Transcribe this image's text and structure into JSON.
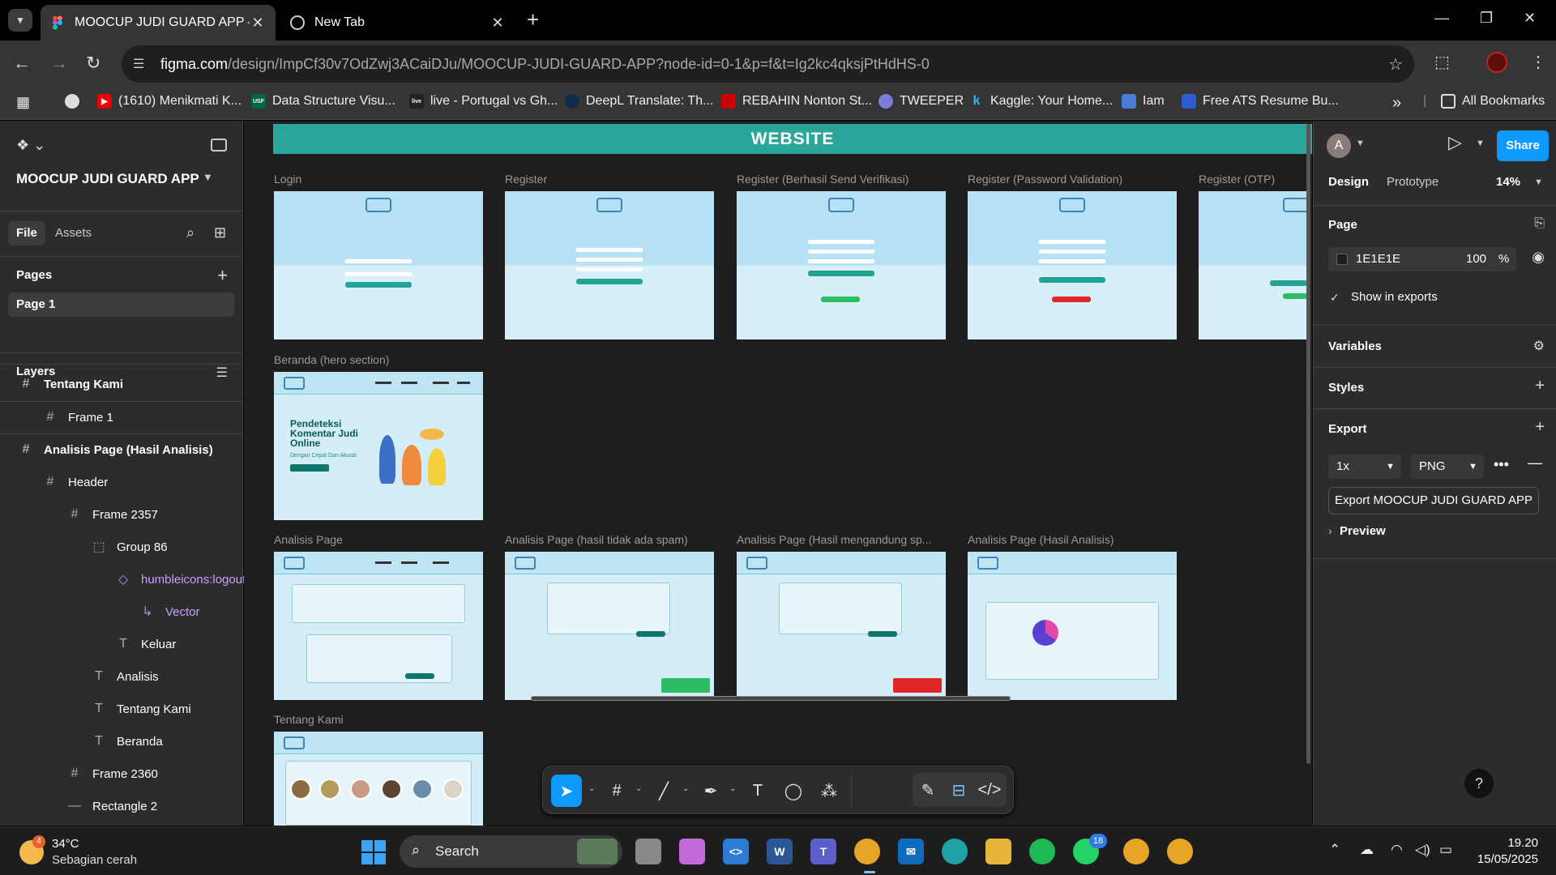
{
  "browser": {
    "tabs": [
      {
        "title": "MOOCUP JUDI GUARD APP – Fi",
        "active": true
      },
      {
        "title": "New Tab",
        "active": false
      }
    ],
    "url_host": "figma.com",
    "url_path": "/design/ImpCf30v7OdZwj3ACaiDJu/MOOCUP-JUDI-GUARD-APP?node-id=0-1&p=f&t=Ig2kc4qksjPtHdHS-0",
    "bookmarks": [
      "(1610) Menikmati K...",
      "Data Structure Visu...",
      "live - Portugal vs Gh...",
      "DeepL Translate: Th...",
      "REBAHIN Nonton St...",
      "TWEEPER",
      "Kaggle: Your Home...",
      "Iam",
      "Free ATS Resume Bu..."
    ],
    "bookmark_more": "»",
    "all_bookmarks": "All Bookmarks"
  },
  "left_panel": {
    "file_name": "MOOCUP JUDI GUARD APP",
    "tabs": [
      "File",
      "Assets"
    ],
    "pages_title": "Pages",
    "pages": [
      "Page 1"
    ],
    "layers_title": "Layers",
    "layers": [
      {
        "name": "Tentang Kami",
        "type": "frame",
        "depth": 0,
        "bold": true
      },
      {
        "name": "Frame 1",
        "type": "frame",
        "depth": 1
      },
      {
        "name": "Analisis Page (Hasil Analisis)",
        "type": "frame",
        "depth": 0,
        "bold": true
      },
      {
        "name": "Header",
        "type": "frame",
        "depth": 1
      },
      {
        "name": "Frame 2357",
        "type": "frame",
        "depth": 2
      },
      {
        "name": "Group 86",
        "type": "group",
        "depth": 3
      },
      {
        "name": "humbleicons:logout",
        "type": "component",
        "depth": 4,
        "purple": true
      },
      {
        "name": "Vector",
        "type": "vector",
        "depth": 5,
        "purple": true
      },
      {
        "name": "Keluar",
        "type": "text",
        "depth": 4
      },
      {
        "name": "Analisis",
        "type": "text",
        "depth": 3
      },
      {
        "name": "Tentang Kami",
        "type": "text",
        "depth": 3
      },
      {
        "name": "Beranda",
        "type": "text",
        "depth": 3
      },
      {
        "name": "Frame 2360",
        "type": "frame",
        "depth": 2
      },
      {
        "name": "Rectangle 2",
        "type": "rect",
        "depth": 2
      }
    ]
  },
  "canvas": {
    "banner": "WEBSITE",
    "frames": [
      "Login",
      "Register",
      "Register (Berhasil Send Verifikasi)",
      "Register (Password Validation)",
      "Register (OTP)",
      "Beranda (hero section)",
      "Analisis Page",
      "Analisis Page (hasil tidak ada spam)",
      "Analisis Page (Hasil mengandung sp...",
      "Analisis Page (Hasil Analisis)",
      "Tentang Kami"
    ],
    "hero_title": "Pendeteksi Komentar Judi Online",
    "hero_subtitle": "Dengan Cepat Dan Akurat"
  },
  "right_panel": {
    "user_initial": "A",
    "share": "Share",
    "tabs": [
      "Design",
      "Prototype"
    ],
    "zoom": "14%",
    "page_section": "Page",
    "page_color": "1E1E1E",
    "page_opacity": "100",
    "percent": "%",
    "show_in_exports": "Show in exports",
    "variables": "Variables",
    "styles": "Styles",
    "export": "Export",
    "export_scale": "1x",
    "export_format": "PNG",
    "export_button": "Export MOOCUP JUDI GUARD APP",
    "preview": "Preview",
    "help": "?"
  },
  "taskbar": {
    "temperature": "34°C",
    "weather": "Sebagian cerah",
    "weather_badge": "4",
    "search": "Search",
    "whatsapp_badge": "18",
    "time": "19.20",
    "date": "15/05/2025"
  }
}
